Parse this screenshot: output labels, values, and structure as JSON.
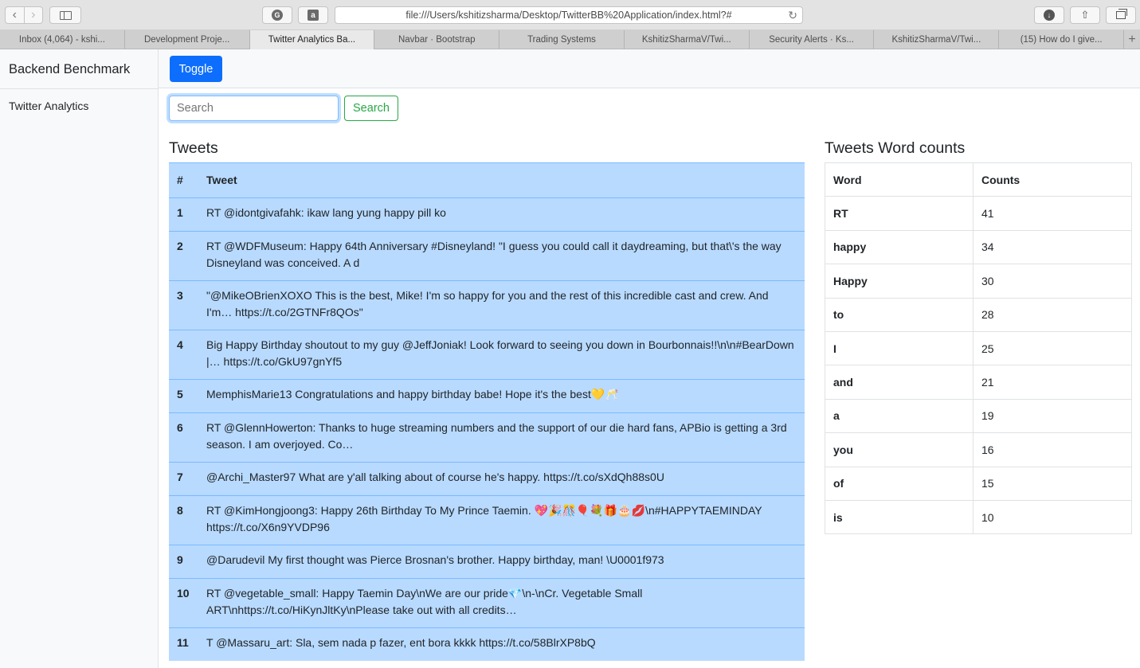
{
  "browser": {
    "url": "file:///Users/kshitizsharma/Desktop/TwitterBB%20Application/index.html?#",
    "tabs": [
      {
        "label": "Inbox (4,064) - kshi..."
      },
      {
        "label": "Development Proje..."
      },
      {
        "label": "Twitter Analytics Ba..."
      },
      {
        "label": "Navbar · Bootstrap"
      },
      {
        "label": "Trading Systems"
      },
      {
        "label": "KshitizSharmaV/Twi..."
      },
      {
        "label": "Security Alerts · Ks..."
      },
      {
        "label": "KshitizSharmaV/Twi..."
      },
      {
        "label": "(15) How do I give..."
      }
    ],
    "active_tab": 2,
    "icons": {
      "back": "chevron-left-icon",
      "forward": "chevron-right-icon",
      "sidebar": "sidebar-icon",
      "reload": "reload-icon",
      "download": "download-icon",
      "share": "share-icon",
      "tabs": "tab-overview-icon"
    }
  },
  "sidebar": {
    "brand": "Backend Benchmark",
    "items": [
      {
        "label": "Twitter Analytics"
      }
    ]
  },
  "navbar": {
    "toggle_label": "Toggle"
  },
  "search": {
    "placeholder": "Search",
    "button_label": "Search"
  },
  "tweets": {
    "heading": "Tweets",
    "columns": [
      "#",
      "Tweet"
    ],
    "rows": [
      {
        "num": "1",
        "text": "RT @idontgivafahk: ikaw lang yung happy pill ko"
      },
      {
        "num": "2",
        "text": "RT @WDFMuseum: Happy 64th Anniversary #Disneyland! \"I guess you could call it daydreaming, but that\\'s the way Disneyland was conceived. A d"
      },
      {
        "num": "3",
        "text": "\"@MikeOBrienXOXO This is the best, Mike! I'm so happy for you and the rest of this incredible cast and crew. And I'm… https://t.co/2GTNFr8QOs\""
      },
      {
        "num": "4",
        "text": "Big Happy Birthday shoutout to my guy @JeffJoniak! Look forward to seeing you down in Bourbonnais!!\\n\\n#BearDown |… https://t.co/GkU97gnYf5"
      },
      {
        "num": "5",
        "text": "MemphisMarie13 Congratulations and happy birthday babe! Hope it's the best💛🥂"
      },
      {
        "num": "6",
        "text": "RT @GlennHowerton: Thanks to huge streaming numbers and the support of our die hard fans, APBio is getting a 3rd season. I am overjoyed. Co…"
      },
      {
        "num": "7",
        "text": "@Archi_Master97 What are y'all talking about of course he's happy. https://t.co/sXdQh88s0U"
      },
      {
        "num": "8",
        "text": "RT @KimHongjoong3: Happy 26th Birthday To My Prince Taemin. 💖🎉🎊🎈💐🎁🎂💋\\n#HAPPYTAEMINDAY https://t.co/X6n9YVDP96"
      },
      {
        "num": "9",
        "text": "@Darudevil My first thought was Pierce Brosnan's brother. Happy birthday, man! \\U0001f973"
      },
      {
        "num": "10",
        "text": "RT @vegetable_small: Happy Taemin Day\\nWe are our pride💎\\n-\\nCr. Vegetable Small ART\\nhttps://t.co/HiKynJltKy\\nPlease take out with all credits…"
      },
      {
        "num": "11",
        "text": "T @Massaru_art: Sla, sem nada p fazer, ent bora kkkk https://t.co/58BlrXP8bQ"
      }
    ]
  },
  "word_counts": {
    "heading": "Tweets Word counts",
    "columns": [
      "Word",
      "Counts"
    ],
    "rows": [
      {
        "word": "RT",
        "count": "41"
      },
      {
        "word": "happy",
        "count": "34"
      },
      {
        "word": "Happy",
        "count": "30"
      },
      {
        "word": "to",
        "count": "28"
      },
      {
        "word": "I",
        "count": "25"
      },
      {
        "word": "and",
        "count": "21"
      },
      {
        "word": "a",
        "count": "19"
      },
      {
        "word": "you",
        "count": "16"
      },
      {
        "word": "of",
        "count": "15"
      },
      {
        "word": "is",
        "count": "10"
      }
    ]
  },
  "colors": {
    "primary": "#0d6efd",
    "success": "#28a745",
    "table_primary": "#b8daff",
    "table_border": "#7abaff"
  }
}
